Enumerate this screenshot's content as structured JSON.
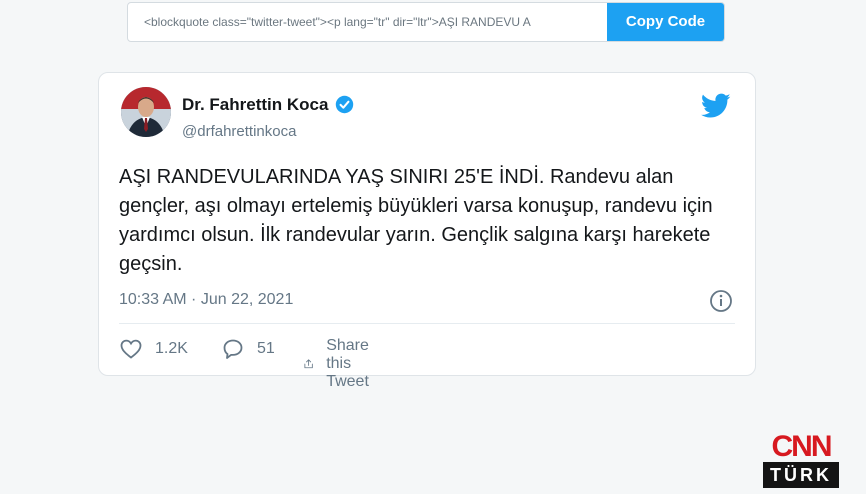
{
  "embed": {
    "code_preview": "<blockquote class=\"twitter-tweet\"><p lang=\"tr\" dir=\"ltr\">AŞI RANDEVU A",
    "copy_label": "Copy Code"
  },
  "tweet": {
    "display_name": "Dr. Fahrettin Koca",
    "handle": "@drfahrettinkoca",
    "text": "AŞI RANDEVULARINDA YAŞ SINIRI 25'E İNDİ. Randevu alan gençler, aşı olmayı ertelemiş büyükleri varsa konuşup, randevu için yardımcı olsun. İlk randevular yarın. Gençlik salgına karşı harekete geçsin.",
    "timestamp": "10:33 AM · Jun 22, 2021",
    "likes": "1.2K",
    "replies": "51",
    "share_label": "Share this Tweet"
  },
  "logo": {
    "top": "CNN",
    "bottom": "TÜRK"
  },
  "colors": {
    "accent": "#1da1f2",
    "brand_red": "#d71920"
  }
}
